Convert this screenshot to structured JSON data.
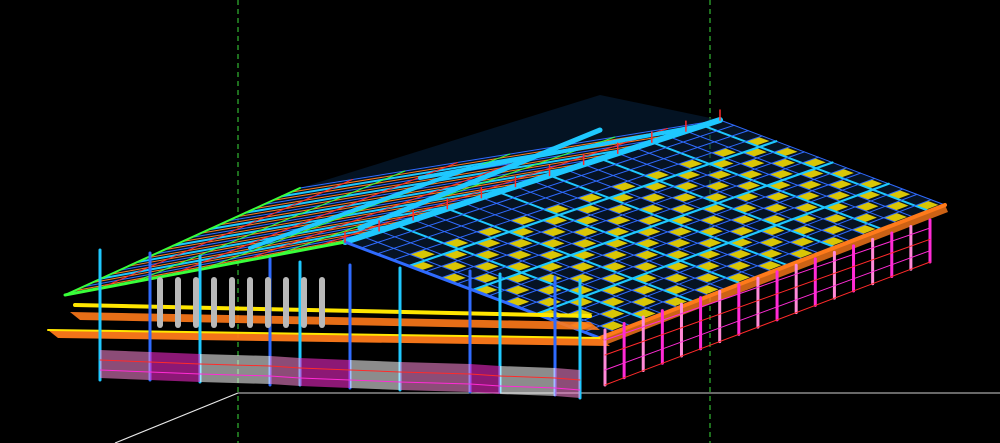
{
  "viewport": {
    "background": "#000000",
    "description_hidden": "",
    "colors": {
      "guide": "#3ddc3d",
      "ground": "#e8e8e8",
      "cyan": "#1ec8ff",
      "blue": "#2f6bff",
      "yellow": "#ffe600",
      "magenta": "#ff2bd6",
      "orange": "#ff7a1a",
      "green": "#39ff3a",
      "red": "#ff2a2a",
      "pink": "#ff8ad8",
      "purple": "#9b3dff",
      "white": "#ffffff",
      "gray": "#b9b9b9"
    }
  }
}
